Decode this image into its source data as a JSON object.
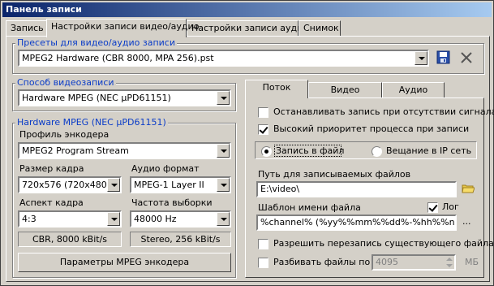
{
  "window": {
    "title": "Панель записи"
  },
  "tabs": [
    {
      "label": "Запись"
    },
    {
      "label": "Настройки записи видео/аудио"
    },
    {
      "label": "Настройки записи аудио"
    },
    {
      "label": "Снимок"
    }
  ],
  "presets": {
    "legend": "Пресеты для видео/аудио записи",
    "selected": "MPEG2 Hardware (CBR 8000, MPA 256).pst",
    "save_icon": "save-icon",
    "delete_icon": "close-icon"
  },
  "method": {
    "legend": "Способ видеозаписи",
    "selected": "Hardware MPEG (NEC µPD61151)"
  },
  "hw": {
    "legend": "Hardware MPEG (NEC µPD61151)",
    "profile_label": "Профиль энкодера",
    "profile_value": "MPEG2 Program Stream",
    "frame_size_label": "Размер кадра",
    "frame_size_value": "720x576 (720x480)",
    "audio_format_label": "Аудио формат",
    "audio_format_value": "MPEG-1 Layer II",
    "aspect_label": "Аспект кадра",
    "aspect_value": "4:3",
    "sample_rate_label": "Частота выборки",
    "sample_rate_value": "48000 Hz",
    "video_bitrate": "CBR, 8000 kBit/s",
    "audio_bitrate": "Stereo, 256 kBit/s",
    "params_button": "Параметры MPEG энкодера"
  },
  "subtabs": [
    {
      "label": "Поток"
    },
    {
      "label": "Видео"
    },
    {
      "label": "Аудио"
    }
  ],
  "stream": {
    "stop_no_signal": "Останавливать запись при отсутствии сигнала",
    "stop_no_signal_checked": false,
    "high_priority": "Высокий приоритет процесса при записи",
    "high_priority_checked": true,
    "record_to_file": "Запись в файл",
    "broadcast_ip": "Вещание в IP сеть",
    "path_label": "Путь для записываемых файлов",
    "path_value": "E:\\video\\",
    "template_label": "Шаблон имени файла",
    "log_label": "Лог",
    "log_checked": true,
    "template_value": "%channel% (%yy%%mm%%dd%-%hh%%nn%",
    "more_button": "...",
    "overwrite": "Разрешить перезапись существующего файла",
    "overwrite_checked": false,
    "split": "Разбивать файлы по",
    "split_checked": false,
    "split_value": "4095",
    "split_unit": "МБ"
  }
}
